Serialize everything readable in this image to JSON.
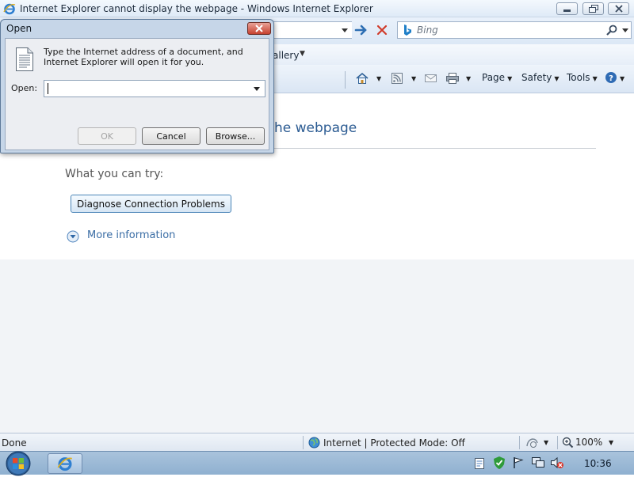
{
  "window": {
    "title": "Internet Explorer cannot display the webpage - Windows Internet Explorer"
  },
  "navigation": {
    "search_placeholder": "Bing"
  },
  "favorites_bar": {
    "gallery_label": "allery"
  },
  "command_bar": {
    "page_label": "Page",
    "safety_label": "Safety",
    "tools_label": "Tools"
  },
  "content": {
    "error_title": "he webpage",
    "try_label": "What you can try:",
    "diagnose_button": "Diagnose Connection Problems",
    "more_info_link": "More information"
  },
  "status_bar": {
    "status": "Done",
    "zone": "Internet | Protected Mode: Off",
    "zoom": "100%"
  },
  "taskbar": {
    "clock": "10:36"
  },
  "open_dialog": {
    "title": "Open",
    "description": "Type the Internet address of a document, and Internet Explorer will open it for you.",
    "open_label": "Open:",
    "open_value": "",
    "ok_label": "OK",
    "cancel_label": "Cancel",
    "browse_label": "Browse..."
  },
  "colors": {
    "accent": "#2b5b92",
    "link": "#3a6da5",
    "close_red": "#c7412f"
  }
}
